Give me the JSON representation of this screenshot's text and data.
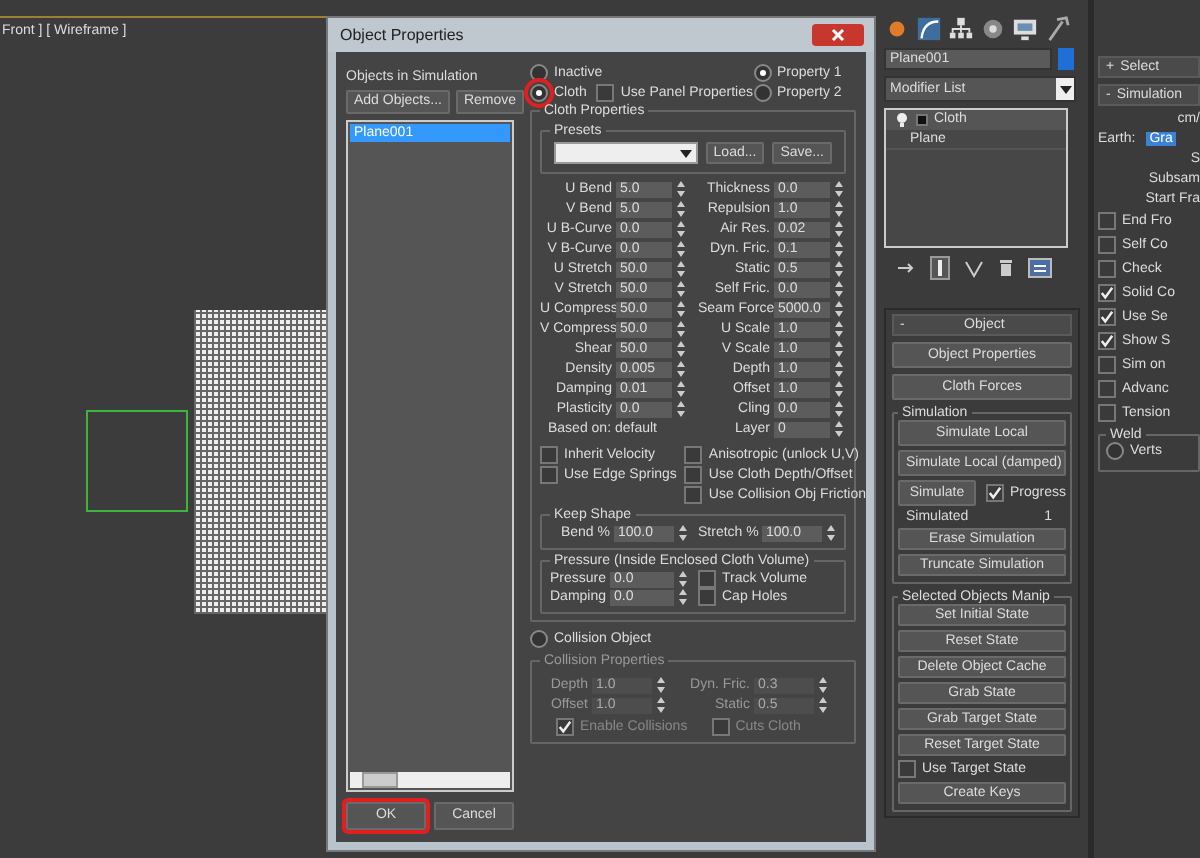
{
  "viewport": {
    "label": "Front ] [ Wireframe ]"
  },
  "dialog": {
    "title": "Object Properties",
    "objects": {
      "heading": "Objects in Simulation",
      "buttons": [
        "Add Objects...",
        "Remove"
      ],
      "items": [
        {
          "label": "Plane001",
          "selected": true
        }
      ]
    },
    "footer_buttons": [
      {
        "label": "OK",
        "highlighted": true
      },
      {
        "label": "Cancel",
        "highlighted": false
      }
    ],
    "mode_options": [
      {
        "label": "Inactive",
        "selected": false,
        "highlighted": false
      },
      {
        "label": "Cloth",
        "selected": true,
        "highlighted": true
      }
    ],
    "use_panel_properties": {
      "label": "Use Panel Properties",
      "checked": false
    },
    "property_options": [
      {
        "label": "Property 1",
        "selected": true
      },
      {
        "label": "Property 2",
        "selected": false
      }
    ],
    "cloth_properties": {
      "title": "Cloth Properties",
      "presets": {
        "title": "Presets",
        "buttons": [
          "Load...",
          "Save..."
        ]
      },
      "params_left": [
        {
          "label": "U Bend",
          "value": "5.0"
        },
        {
          "label": "V Bend",
          "value": "5.0"
        },
        {
          "label": "U B-Curve",
          "value": "0.0"
        },
        {
          "label": "V B-Curve",
          "value": "0.0"
        },
        {
          "label": "U Stretch",
          "value": "50.0"
        },
        {
          "label": "V Stretch",
          "value": "50.0"
        },
        {
          "label": "U Compress",
          "value": "50.0"
        },
        {
          "label": "V Compress",
          "value": "50.0"
        },
        {
          "label": "Shear",
          "value": "50.0"
        },
        {
          "label": "Density",
          "value": "0.005"
        },
        {
          "label": "Damping",
          "value": "0.01"
        },
        {
          "label": "Plasticity",
          "value": "0.0"
        }
      ],
      "params_right": [
        {
          "label": "Thickness",
          "value": "0.0"
        },
        {
          "label": "Repulsion",
          "value": "1.0"
        },
        {
          "label": "Air Res.",
          "value": "0.02"
        },
        {
          "label": "Dyn. Fric.",
          "value": "0.1"
        },
        {
          "label": "Static",
          "value": "0.5"
        },
        {
          "label": "Self Fric.",
          "value": "0.0"
        },
        {
          "label": "Seam Force",
          "value": "5000.0"
        },
        {
          "label": "U Scale",
          "value": "1.0"
        },
        {
          "label": "V Scale",
          "value": "1.0"
        },
        {
          "label": "Depth",
          "value": "1.0"
        },
        {
          "label": "Offset",
          "value": "1.0"
        },
        {
          "label": "Cling",
          "value": "0.0"
        }
      ],
      "based_on": "Based on: default",
      "layer": {
        "label": "Layer",
        "value": "0"
      },
      "checkboxes_left": [
        {
          "label": "Inherit Velocity",
          "checked": false
        },
        {
          "label": "Use Edge Springs",
          "checked": false
        }
      ],
      "checkboxes_right": [
        {
          "label": "Anisotropic (unlock U,V)",
          "checked": false
        },
        {
          "label": "Use Cloth Depth/Offset",
          "checked": false
        },
        {
          "label": "Use Collision Obj Friction",
          "checked": false
        }
      ],
      "keep_shape": {
        "title": "Keep Shape",
        "fields": [
          {
            "label": "Bend %",
            "value": "100.0"
          },
          {
            "label": "Stretch %",
            "value": "100.0"
          }
        ]
      },
      "pressure": {
        "title": "Pressure (Inside Enclosed Cloth Volume)",
        "fields": [
          {
            "label": "Pressure",
            "value": "0.0"
          },
          {
            "label": "Damping",
            "value": "0.0"
          }
        ],
        "checkboxes": [
          {
            "label": "Track Volume",
            "checked": false
          },
          {
            "label": "Cap Holes",
            "checked": false
          }
        ]
      }
    },
    "collision_object": {
      "label": "Collision Object",
      "selected": false
    },
    "collision_properties": {
      "title": "Collision Properties",
      "disabled": true,
      "fields_left": [
        {
          "label": "Depth",
          "value": "1.0"
        },
        {
          "label": "Offset",
          "value": "1.0"
        }
      ],
      "fields_right": [
        {
          "label": "Dyn. Fric.",
          "value": "0.3"
        },
        {
          "label": "Static",
          "value": "0.5"
        }
      ],
      "checkboxes": [
        {
          "label": "Enable Collisions",
          "checked": true
        },
        {
          "label": "Cuts Cloth",
          "checked": false
        }
      ]
    }
  },
  "command_panel": {
    "object_name": "Plane001",
    "modifier_list": "Modifier List",
    "stack": [
      {
        "label": "Cloth",
        "selected": true
      },
      {
        "label": "Plane",
        "selected": false
      }
    ],
    "object_rollout": {
      "toggle": "-",
      "title": "Object",
      "buttons": [
        "Object Properties",
        "Cloth Forces"
      ]
    },
    "simulation": {
      "title": "Simulation",
      "buttons_top": [
        "Simulate Local",
        "Simulate Local (damped)"
      ],
      "simulate": "Simulate",
      "progress": {
        "label": "Progress",
        "checked": true
      },
      "status_label": "Simulated",
      "status_value": "1",
      "buttons_bottom": [
        "Erase Simulation",
        "Truncate Simulation"
      ]
    },
    "manip": {
      "title": "Selected Objects Manip",
      "buttons": [
        "Set Initial State",
        "Reset State",
        "Delete Object Cache",
        "Grab State",
        "Grab Target State",
        "Reset Target State"
      ],
      "use_target_state": {
        "label": "Use Target State",
        "checked": false
      },
      "create_keys": "Create Keys"
    }
  },
  "side_panel": {
    "select": {
      "toggle": "+",
      "title": "Select"
    },
    "rollout": {
      "toggle": "-",
      "title": "Simulation"
    },
    "units": "cm/",
    "gravity_label": "Earth:",
    "gravity_value": "Gra",
    "labels": [
      "S",
      "Subsam",
      "Start Fra"
    ],
    "checkboxes": [
      {
        "label": "End Fro",
        "checked": false
      },
      {
        "label": "Self Co",
        "checked": false
      },
      {
        "label": "Check",
        "checked": false
      },
      {
        "label": "Solid Co",
        "checked": true
      },
      {
        "label": "Use Se",
        "checked": true
      },
      {
        "label": "Show S",
        "checked": true
      },
      {
        "label": "Sim on",
        "checked": false
      },
      {
        "label": "Advanc",
        "checked": false
      },
      {
        "label": "Tension",
        "checked": false
      }
    ],
    "weld": {
      "title": "Weld",
      "option": {
        "label": "Verts",
        "selected": false
      }
    }
  }
}
